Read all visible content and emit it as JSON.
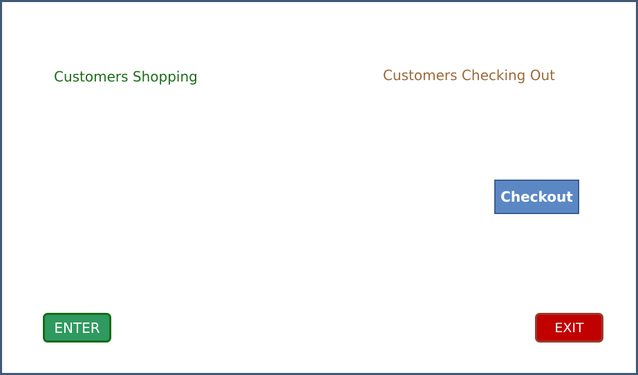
{
  "areas": {
    "shopping_label": "Customers Shopping",
    "checking_out_label": "Customers Checking Out"
  },
  "buttons": {
    "checkout_label": "Checkout",
    "enter_label": "ENTER",
    "exit_label": "EXIT"
  },
  "colors": {
    "frame_border": "#3f5a78",
    "shopping_text": "#1e6b1e",
    "checking_out_text": "#9a6a3a",
    "checkout_fill": "#5b88c4",
    "enter_fill": "#2e9a5f",
    "exit_fill": "#c10000"
  }
}
